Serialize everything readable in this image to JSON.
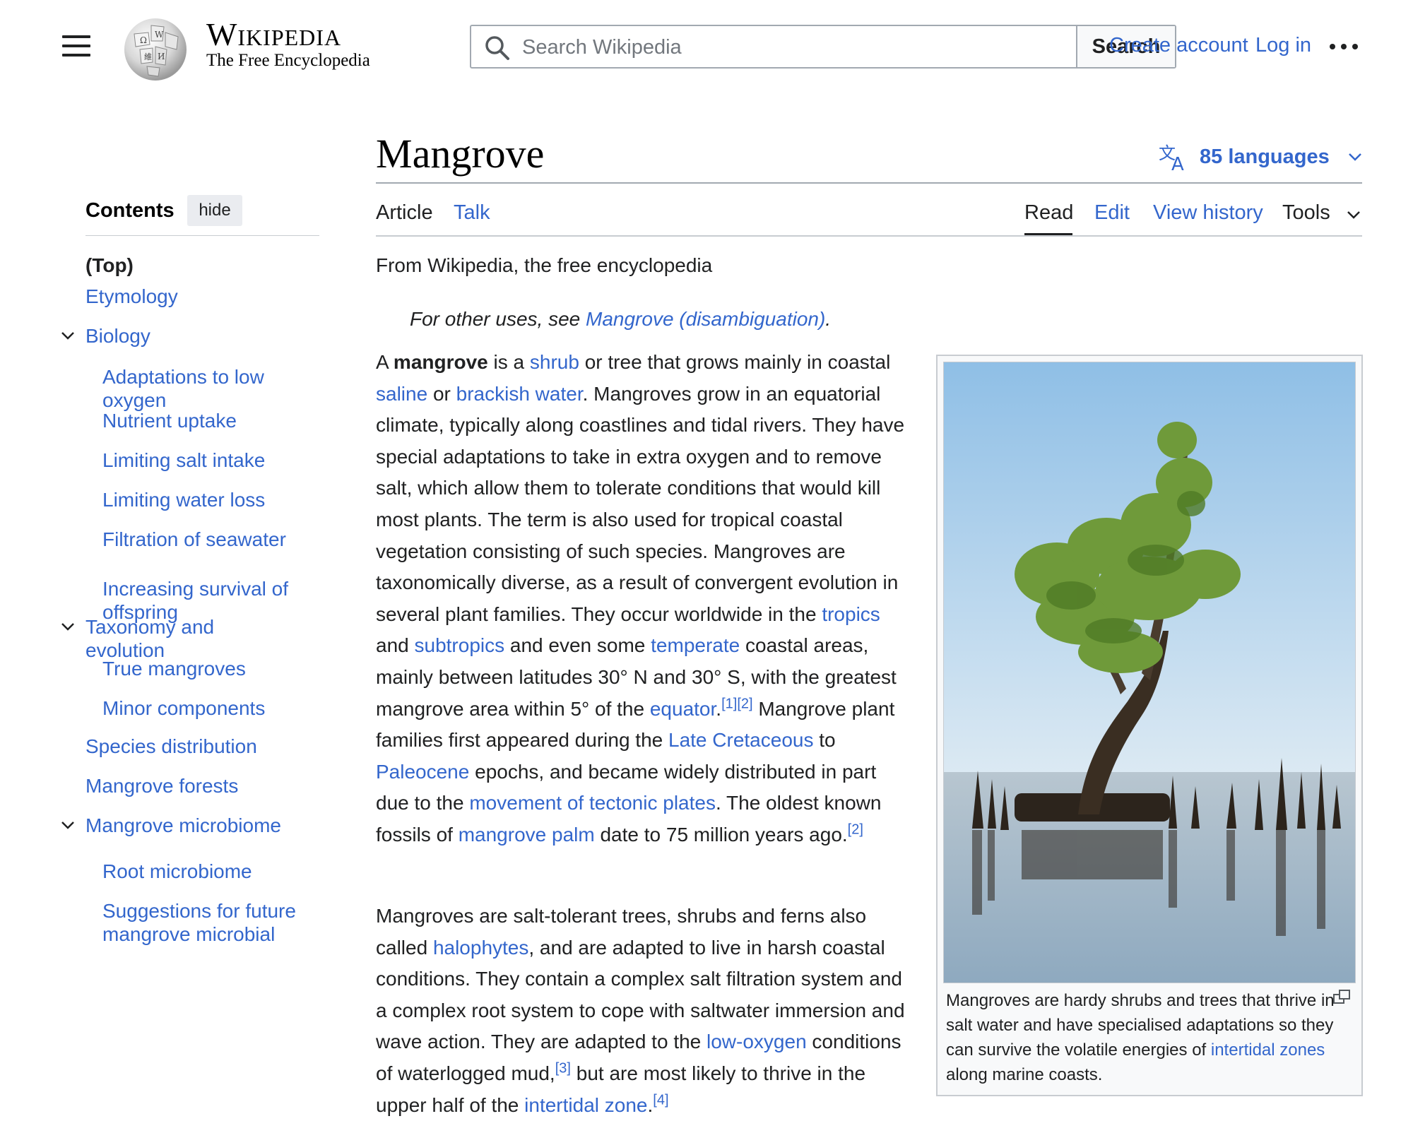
{
  "header": {
    "wordmark": "Wikipedia",
    "tagline": "The Free Encyclopedia",
    "search_placeholder": "Search Wikipedia",
    "search_button": "Search",
    "create_account": "Create account",
    "log_in": "Log in",
    "icons": [
      "menu-icon",
      "wikipedia-globe-logo",
      "search-icon",
      "more-options-icon"
    ]
  },
  "page": {
    "title": "Mangrove",
    "languages_label": "85 languages",
    "tabs_left": [
      "Article",
      "Talk"
    ],
    "tabs_right": [
      "Read",
      "Edit",
      "View history",
      "Tools"
    ],
    "active_tab": "Read"
  },
  "toc": {
    "title": "Contents",
    "hide_label": "hide",
    "top_label": "(Top)",
    "items": [
      {
        "label": "Etymology",
        "level": 1,
        "collapsible": false
      },
      {
        "label": "Biology",
        "level": 1,
        "collapsible": true
      },
      {
        "label": "Adaptations to low oxygen",
        "level": 2
      },
      {
        "label": "Nutrient uptake",
        "level": 2
      },
      {
        "label": "Limiting salt intake",
        "level": 2
      },
      {
        "label": "Limiting water loss",
        "level": 2
      },
      {
        "label": "Filtration of seawater",
        "level": 2
      },
      {
        "label": "Increasing survival of offspring",
        "level": 2
      },
      {
        "label": "Taxonomy and evolution",
        "level": 1,
        "collapsible": true
      },
      {
        "label": "True mangroves",
        "level": 2
      },
      {
        "label": "Minor components",
        "level": 2
      },
      {
        "label": "Species distribution",
        "level": 1,
        "collapsible": false
      },
      {
        "label": "Mangrove forests",
        "level": 1,
        "collapsible": false
      },
      {
        "label": "Mangrove microbiome",
        "level": 1,
        "collapsible": true
      },
      {
        "label": "Root microbiome",
        "level": 2
      },
      {
        "label": "Suggestions for future mangrove microbial",
        "level": 2
      }
    ]
  },
  "article": {
    "from_line": "From Wikipedia, the free encyclopedia",
    "hatnote": {
      "prefix": "For other uses, see ",
      "link": "Mangrove (disambiguation)",
      "suffix": "."
    },
    "paragraphs": [
      [
        {
          "t": "A "
        },
        {
          "t": "mangrove",
          "bold": true
        },
        {
          "t": " is a "
        },
        {
          "t": "shrub",
          "link": true
        },
        {
          "t": " or tree that grows mainly in coastal "
        },
        {
          "t": "saline",
          "link": true
        },
        {
          "t": " or "
        },
        {
          "t": "brackish water",
          "link": true
        },
        {
          "t": ". Mangroves grow in an equatorial climate, typically along coastlines and tidal rivers. They have special adaptations to take in extra oxygen and to remove salt, which allow them to tolerate conditions that would kill most plants. The term is also used for tropical coastal vegetation consisting of such species. Mangroves are taxonomically diverse, as a result of convergent evolution in several plant families. They occur worldwide in the "
        },
        {
          "t": "tropics",
          "link": true
        },
        {
          "t": " and "
        },
        {
          "t": "subtropics",
          "link": true
        },
        {
          "t": " and even some "
        },
        {
          "t": "temperate",
          "link": true
        },
        {
          "t": " coastal areas, mainly between latitudes 30° N and 30° S, with the greatest mangrove area within 5° of the "
        },
        {
          "t": "equator",
          "link": true
        },
        {
          "t": "."
        },
        {
          "t": "[1]",
          "sup": true
        },
        {
          "t": "[2]",
          "sup": true
        },
        {
          "t": " Mangrove plant families first appeared during the "
        },
        {
          "t": "Late Cretaceous",
          "link": true
        },
        {
          "t": " to "
        },
        {
          "t": "Paleocene",
          "link": true
        },
        {
          "t": " epochs, and became widely distributed in part due to the "
        },
        {
          "t": "movement of tectonic plates",
          "link": true
        },
        {
          "t": ". The oldest known fossils of "
        },
        {
          "t": "mangrove palm",
          "link": true
        },
        {
          "t": " date to 75 million years ago."
        },
        {
          "t": "[2]",
          "sup": true
        }
      ],
      [
        {
          "t": "Mangroves are salt-tolerant trees, shrubs and ferns also called "
        },
        {
          "t": "halophytes",
          "link": true
        },
        {
          "t": ", and are adapted to live in harsh coastal conditions. They contain a complex salt filtration system and a complex root system to cope with saltwater immersion and wave action. They are adapted to the "
        },
        {
          "t": "low-oxygen",
          "link": true
        },
        {
          "t": " conditions of waterlogged mud,"
        },
        {
          "t": "[3]",
          "sup": true
        },
        {
          "t": " but are most likely to thrive in the upper half of the "
        },
        {
          "t": "intertidal zone",
          "link": true
        },
        {
          "t": "."
        },
        {
          "t": "[4]",
          "sup": true
        }
      ]
    ]
  },
  "figure": {
    "caption": [
      {
        "t": "Mangroves are hardy shrubs and trees that thrive in salt water and have specialised adaptations so they can survive the volatile energies of "
      },
      {
        "t": "intertidal zones",
        "link": true
      },
      {
        "t": " along marine coasts."
      }
    ],
    "image_subject": "mangrove tree standing in shallow water with dead stumps",
    "colors": {
      "sky_top": "#8fbfe6",
      "sky_bottom": "#dbe9f3",
      "water": "#9fb5c6",
      "foliage": "#6f9a3a"
    }
  }
}
